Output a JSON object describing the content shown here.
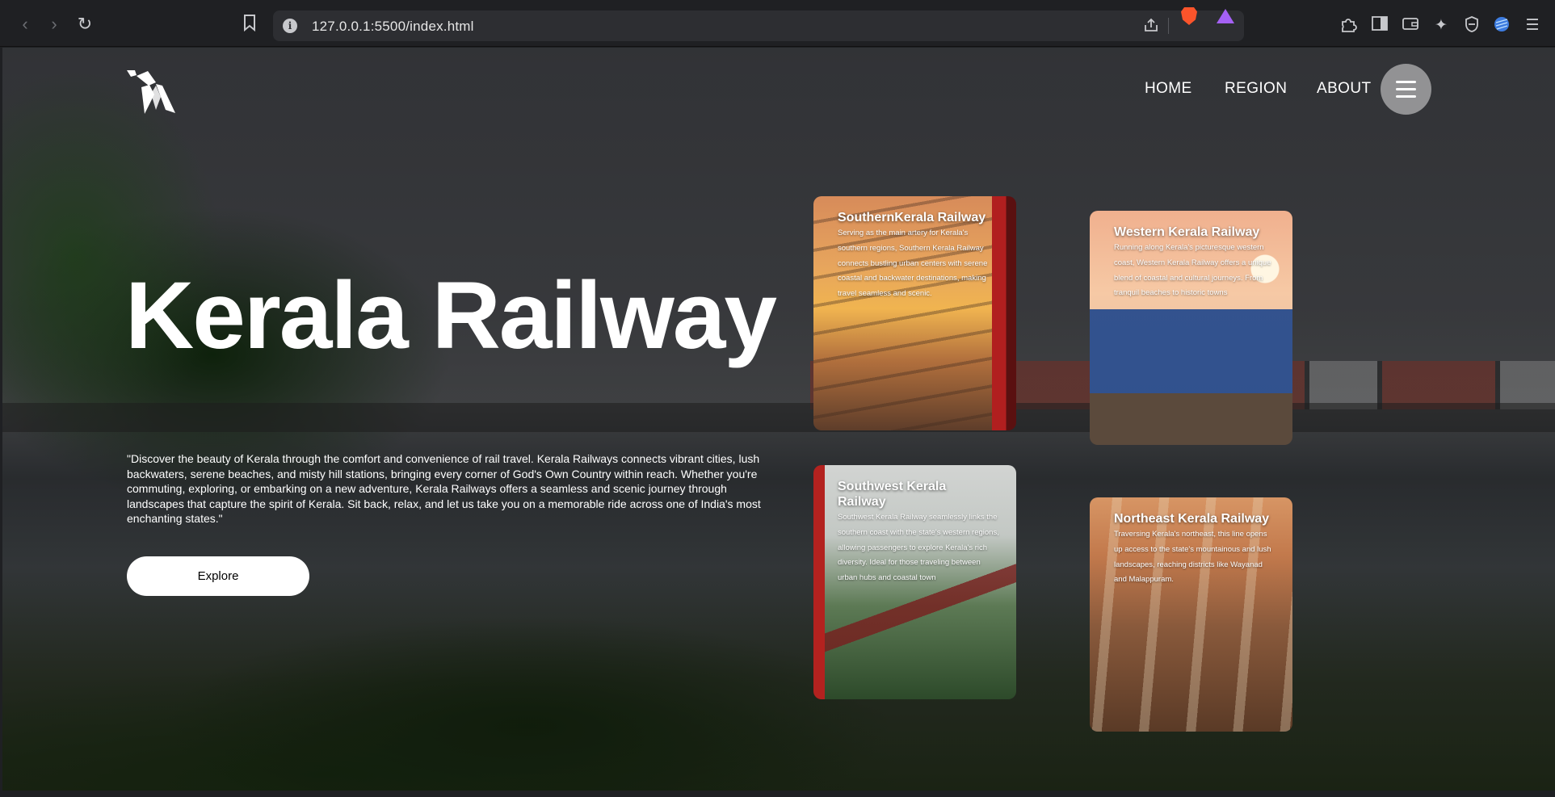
{
  "browser": {
    "url": "127.0.0.1:5500/index.html",
    "icons": [
      "back-icon",
      "forward-icon",
      "reload-icon",
      "bookmark-icon",
      "site-info-icon",
      "share-icon",
      "brave-shields-icon",
      "brave-rewards-icon",
      "extensions-icon",
      "sidebar-icon",
      "wallet-icon",
      "leo-ai-icon",
      "vpn-icon",
      "profile-icon",
      "menu-icon"
    ]
  },
  "nav": {
    "items": [
      "HOME",
      "REGION",
      "ABOUT"
    ]
  },
  "hero": {
    "title": "Kerala Railway",
    "description": "\"Discover the beauty of Kerala through the comfort and convenience of rail travel. Kerala Railways connects vibrant cities, lush backwaters, serene beaches, and misty hill stations, bringing every corner of God's Own Country within reach. Whether you're commuting, exploring, or embarking on a new adventure, Kerala Railways offers a seamless and scenic journey through landscapes that capture the spirit of Kerala. Sit back, relax, and let us take you on a memorable ride across one of India's most enchanting states.\"",
    "button_label": "Explore"
  },
  "cards": [
    {
      "title": "SouthernKerala Railway",
      "text": "Serving as the main artery for Kerala's southern regions, Southern Kerala Railway connects bustling urban centers with serene coastal and backwater destinations, making travel seamless and scenic."
    },
    {
      "title": "Western Kerala Railway",
      "text": "Running along Kerala's picturesque western coast, Western Kerala Railway offers a unique blend of coastal and cultural journeys. From tranquil beaches to historic towns"
    },
    {
      "title": "Southwest Kerala Railway",
      "text": "Southwest Kerala Railway seamlessly links the southern coast with the state's western regions, allowing passengers to explore Kerala's rich diversity. Ideal for those traveling between urban hubs and coastal town"
    },
    {
      "title": "Northeast Kerala Railway",
      "text": "Traversing Kerala's northeast, this line opens up access to the state's mountainous and lush landscapes, reaching districts like Wayanad and Malappuram."
    }
  ]
}
